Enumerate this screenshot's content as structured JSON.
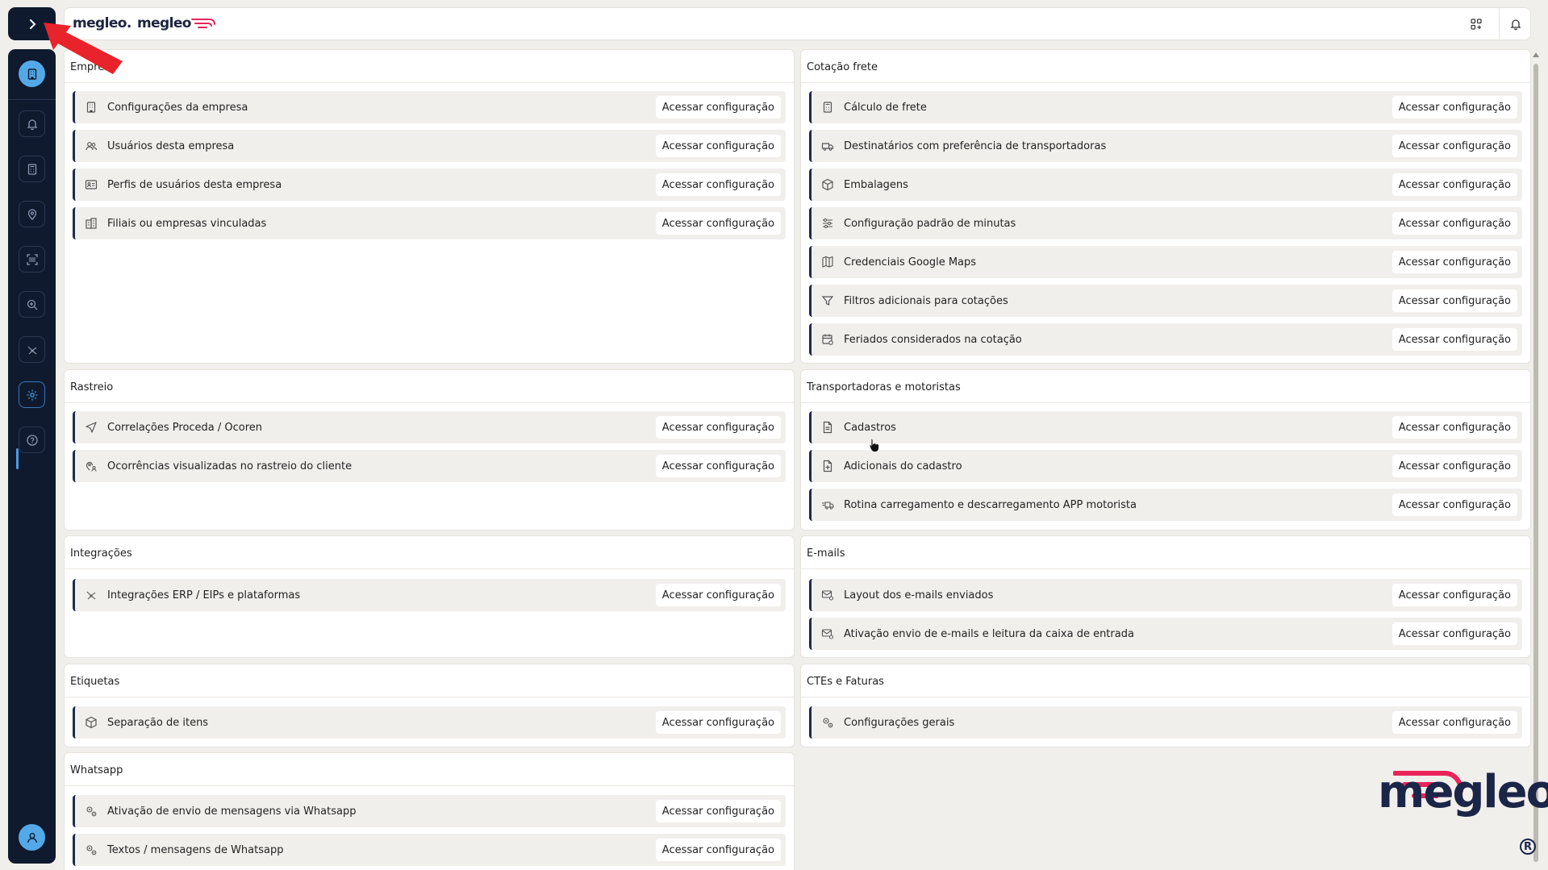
{
  "header": {
    "logo_left": "megleo",
    "logo_right": "megleo",
    "apps_icon": "apps-grid-icon",
    "bell_icon": "bell-icon"
  },
  "sidebar": {
    "toggle_icon": "chevron-right-icon",
    "items": [
      {
        "icon": "bell-icon"
      },
      {
        "icon": "calculator-icon"
      },
      {
        "icon": "map-pin-icon"
      },
      {
        "icon": "barcode-scan-icon"
      },
      {
        "icon": "search-zoom-icon"
      },
      {
        "icon": "integrations-icon"
      },
      {
        "icon": "gear-icon",
        "active": true
      },
      {
        "icon": "help-icon"
      }
    ]
  },
  "action_label": "Acessar configuração",
  "sections": {
    "empresa": {
      "title": "Empresa",
      "items": [
        {
          "label": "Configurações da empresa",
          "icon": "building-icon"
        },
        {
          "label": "Usuários desta empresa",
          "icon": "users-icon"
        },
        {
          "label": "Perfis de usuários desta empresa",
          "icon": "id-card-icon"
        },
        {
          "label": "Filiais ou empresas vinculadas",
          "icon": "buildings-icon"
        }
      ]
    },
    "cotacao": {
      "title": "Cotação frete",
      "items": [
        {
          "label": "Cálculo de frete",
          "icon": "calculator-icon"
        },
        {
          "label": "Destinatários com preferência de transportadoras",
          "icon": "truck-icon"
        },
        {
          "label": "Embalagens",
          "icon": "package-icon"
        },
        {
          "label": "Configuração padrão de minutas",
          "icon": "sliders-icon"
        },
        {
          "label": "Credenciais Google Maps",
          "icon": "map-icon"
        },
        {
          "label": "Filtros adicionais para cotações",
          "icon": "filter-icon"
        },
        {
          "label": "Feriados considerados na cotação",
          "icon": "calendar-icon"
        }
      ]
    },
    "rastreio": {
      "title": "Rastreio",
      "items": [
        {
          "label": "Correlações Proceda / Ocoren",
          "icon": "navigation-icon"
        },
        {
          "label": "Ocorrências visualizadas no rastreio do cliente",
          "icon": "location-user-icon"
        }
      ]
    },
    "transportadoras": {
      "title": "Transportadoras e motoristas",
      "items": [
        {
          "label": "Cadastros",
          "icon": "document-icon"
        },
        {
          "label": "Adicionais do cadastro",
          "icon": "document-plus-icon"
        },
        {
          "label": "Rotina carregamento e descarregamento APP motorista",
          "icon": "truck-fast-icon"
        }
      ]
    },
    "integracoes": {
      "title": "Integrações",
      "items": [
        {
          "label": "Integrações ERP / EIPs e plataformas",
          "icon": "integrations-icon"
        }
      ]
    },
    "emails": {
      "title": "E-mails",
      "items": [
        {
          "label": "Layout dos e-mails enviados",
          "icon": "mail-settings-icon"
        },
        {
          "label": "Ativação envio de e-mails e leitura da caixa de entrada",
          "icon": "mail-settings-icon"
        }
      ]
    },
    "etiquetas": {
      "title": "Etiquetas",
      "items": [
        {
          "label": "Separação de itens",
          "icon": "package-icon"
        }
      ]
    },
    "ctes": {
      "title": "CTEs e Faturas",
      "items": [
        {
          "label": "Configurações gerais",
          "icon": "gears-icon"
        }
      ]
    },
    "whatsapp": {
      "title": "Whatsapp",
      "items": [
        {
          "label": "Ativação de envio de mensagens via Whatsapp",
          "icon": "gears-icon"
        },
        {
          "label": "Textos / mensagens de Whatsapp",
          "icon": "gears-icon"
        }
      ]
    }
  },
  "watermark": {
    "text": "megleo",
    "reg": "R"
  },
  "colors": {
    "sidebar": "#0f1a2e",
    "accent": "#53a9e8",
    "brand_red": "#e8245a",
    "item_bg": "#f1efec"
  }
}
